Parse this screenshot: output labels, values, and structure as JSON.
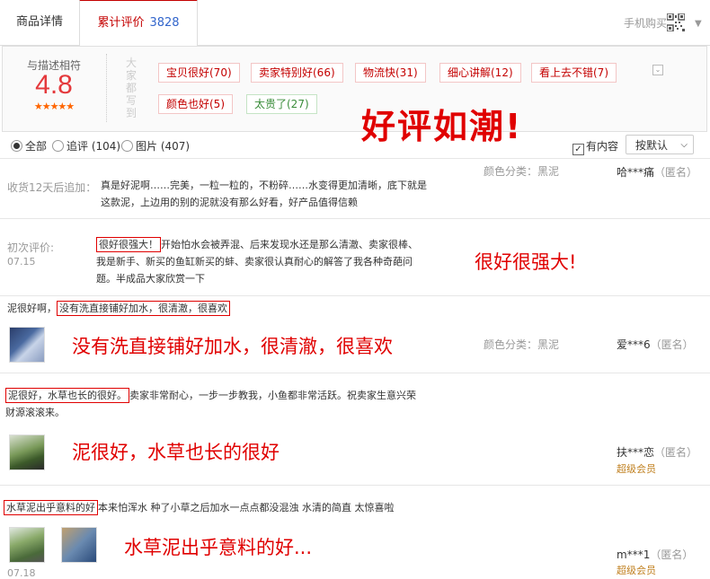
{
  "tabs": {
    "details": "商品详情",
    "reviews": "累计评价",
    "reviews_count": "3828",
    "mobile_buy": "手机购买"
  },
  "summary": {
    "score_label": "与描述相符",
    "score": "4.8",
    "stars": "★★★★★",
    "vertical_label": "大家都写到",
    "tags": [
      {
        "label": "宝贝很好(70)",
        "color": "red"
      },
      {
        "label": "卖家特别好(66)",
        "color": "red"
      },
      {
        "label": "物流快(31)",
        "color": "red"
      },
      {
        "label": "细心讲解(12)",
        "color": "red"
      },
      {
        "label": "看上去不错(7)",
        "color": "red"
      },
      {
        "label": "颜色也好(5)",
        "color": "red"
      },
      {
        "label": "太贵了(27)",
        "color": "green"
      }
    ],
    "overlay": "好评如潮!"
  },
  "filter": {
    "all": "全部",
    "followup": "追评 (104)",
    "images": "图片 (407)",
    "has_content": "有内容",
    "sort": "按默认"
  },
  "reviews": [
    {
      "prefix": "收货12天后追加：",
      "text_line1": "真是好泥啊……完美，一粒一粒的，不粉碎……水变得更加清晰，底下就是",
      "text_line2": "这款泥，上边用的别的泥就没有那么好看，好产品值得信赖",
      "color_label": "颜色分类：黑泥",
      "user": "哈***痛",
      "anon": "（匿名）"
    },
    {
      "initial_label": "初次评价:",
      "date": "07.15",
      "highlight": "很好很强大！",
      "text_line1": "开始怕水会被弄混、后来发现水还是那么清澈、卖家很棒、",
      "text_line2": "我是新手、新买的鱼缸新买的蚌、卖家很认真耐心的解答了我各种奇葩问",
      "text_line3": "题。半成品大家欣赏一下",
      "overlay": "很好很强大!"
    },
    {
      "prefix": "泥很好啊，",
      "highlight": "没有洗直接铺好加水，很清澈，很喜欢",
      "overlay": "没有洗直接铺好加水，很清澈，很喜欢",
      "color_label": "颜色分类：黑泥",
      "user": "爱***6",
      "anon": "（匿名）"
    },
    {
      "highlight": "泥很好，水草也长的很好。",
      "text_line1": "卖家非常耐心，一步一步教我，小鱼都非常活跃。祝卖家生意兴荣",
      "text_line2": "财源滚滚来。",
      "overlay": "泥很好，水草也长的很好",
      "user": "扶***恋",
      "anon": "（匿名）",
      "vip": "超级会员"
    },
    {
      "highlight": "水草泥出乎意料的好",
      "text_line1": "本来怕浑水 种了小草之后加水一点点都没混浊 水清的简直 太惊喜啦",
      "overlay": "水草泥出乎意料的好...",
      "user": "m***1",
      "anon": "（匿名）",
      "vip": "超级会员",
      "date": "07.18"
    }
  ]
}
